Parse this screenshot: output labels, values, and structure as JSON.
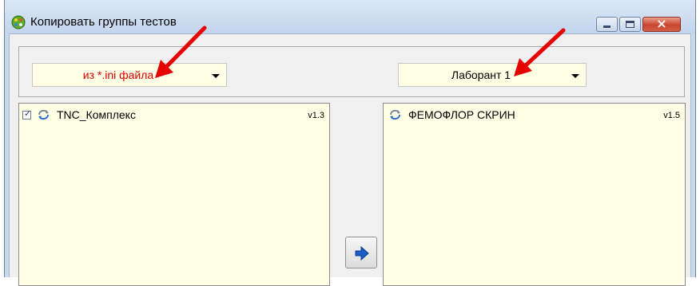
{
  "window": {
    "title": "Копировать группы тестов",
    "close_glyph": "×"
  },
  "source": {
    "selected": "из *.ini файла",
    "items": [
      {
        "checked": true,
        "label": "TNC_Комплекс",
        "version": "v1.3"
      }
    ]
  },
  "target": {
    "selected": "Лаборант 1",
    "items": [
      {
        "label": "ФЕМОФЛОР СКРИН",
        "version": "v1.5"
      }
    ]
  },
  "colors": {
    "list_bg": "#ffffe6",
    "source_text": "#e00000",
    "arrow_blue": "#1a5fc9",
    "annotation_red": "#e60000"
  },
  "icons": {
    "app": "palette-icon",
    "sync": "refresh-icon",
    "move": "arrow-right-icon"
  }
}
